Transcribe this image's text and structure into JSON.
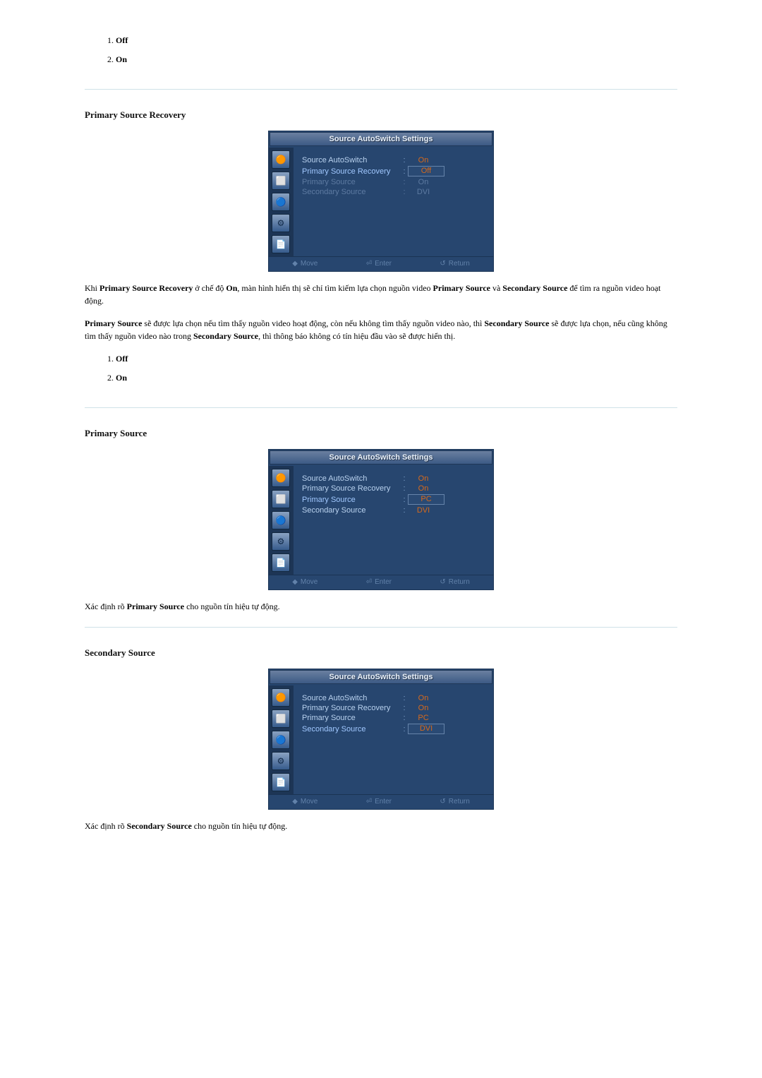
{
  "intro_options": {
    "items": [
      "Off",
      "On"
    ]
  },
  "section1": {
    "heading": "Primary Source Recovery",
    "osd_title": "Source AutoSwitch Settings",
    "rows": [
      {
        "label": "Source AutoSwitch",
        "value": "On",
        "highlight": false,
        "selected": false,
        "disabled": false
      },
      {
        "label": "Primary Source Recovery",
        "value": "Off",
        "highlight": true,
        "selected": true,
        "disabled": false
      },
      {
        "label": "Primary Source",
        "value": "On",
        "highlight": false,
        "selected": false,
        "disabled": true
      },
      {
        "label": "Secondary Source",
        "value": "DVI",
        "highlight": false,
        "selected": false,
        "disabled": true
      }
    ],
    "footer": {
      "move": "Move",
      "enter": "Enter",
      "return": "Return"
    },
    "para1_a": "Khi ",
    "para1_b": " ở chế độ ",
    "para1_c": ", màn hình hiển thị sẽ chỉ tìm kiếm lựa chọn nguồn video ",
    "para1_d": " và ",
    "para1_e": " để tìm ra nguồn video hoạt động.",
    "strong1": "Primary Source Recovery",
    "strong2": "On",
    "strong3": "Primary Source",
    "strong4": "Secondary Source",
    "para2_a": "",
    "para2_b": " sẽ được lựa chọn nếu tìm thấy nguồn video hoạt động, còn nếu không tìm thấy nguồn video nào, thì ",
    "para2_c": " sẽ được lựa chọn, nếu cũng không tìm thấy nguồn video nào trong ",
    "para2_d": ", thì thông báo không có tín hiệu đầu vào sẽ được hiển thị.",
    "strong5": "Primary Source",
    "strong6": "Secondary Source",
    "strong7": "Secondary Source",
    "options": [
      "Off",
      "On"
    ]
  },
  "section2": {
    "heading": "Primary Source",
    "osd_title": "Source AutoSwitch Settings",
    "rows": [
      {
        "label": "Source AutoSwitch",
        "value": "On",
        "highlight": false,
        "selected": false,
        "disabled": false
      },
      {
        "label": "Primary Source Recovery",
        "value": "On",
        "highlight": false,
        "selected": false,
        "disabled": false
      },
      {
        "label": "Primary Source",
        "value": "PC",
        "highlight": true,
        "selected": true,
        "disabled": false
      },
      {
        "label": "Secondary Source",
        "value": "DVI",
        "highlight": false,
        "selected": false,
        "disabled": false
      }
    ],
    "footer": {
      "move": "Move",
      "enter": "Enter",
      "return": "Return"
    },
    "para_a": "Xác định rõ ",
    "para_b": " cho nguồn tín hiệu tự động.",
    "strong": "Primary Source"
  },
  "section3": {
    "heading": "Secondary Source",
    "osd_title": "Source AutoSwitch Settings",
    "rows": [
      {
        "label": "Source AutoSwitch",
        "value": "On",
        "highlight": false,
        "selected": false,
        "disabled": false
      },
      {
        "label": "Primary Source Recovery",
        "value": "On",
        "highlight": false,
        "selected": false,
        "disabled": false
      },
      {
        "label": "Primary Source",
        "value": "PC",
        "highlight": false,
        "selected": false,
        "disabled": false
      },
      {
        "label": "Secondary Source",
        "value": "DVI",
        "highlight": true,
        "selected": true,
        "disabled": false
      }
    ],
    "footer": {
      "move": "Move",
      "enter": "Enter",
      "return": "Return"
    },
    "para_a": "Xác định rõ ",
    "para_b": " cho nguồn tín hiệu tự động.",
    "strong": "Secondary Source"
  },
  "sidebar_icons": [
    "🟠",
    "⬜",
    "🔵",
    "⚙",
    "📄"
  ]
}
